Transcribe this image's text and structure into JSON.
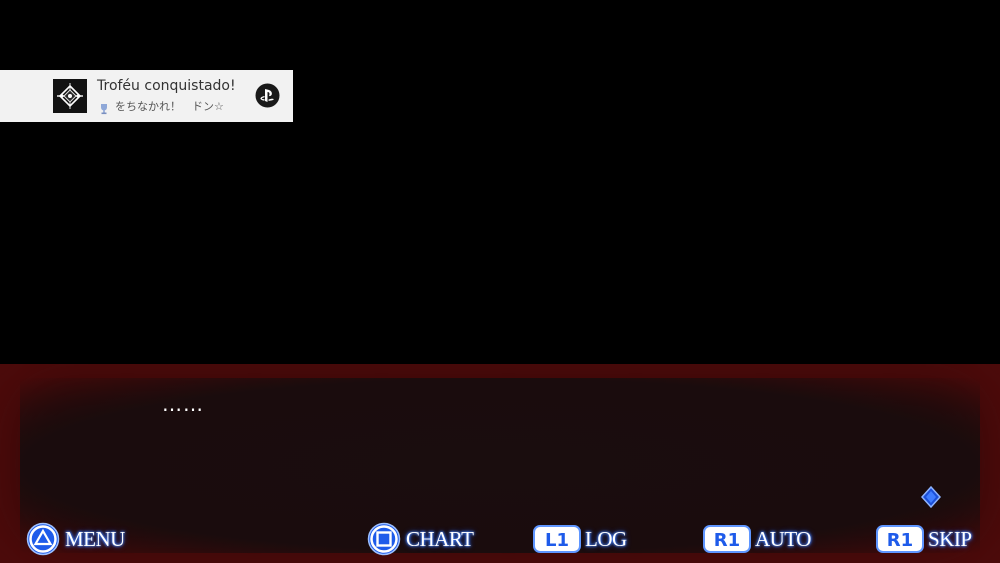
{
  "trophy_notification": {
    "title": "Troféu conquistado!",
    "trophy_name": "をちなかれ！　ドン☆",
    "tier_icon": "silver-trophy-icon",
    "platform_icon": "playstation-logo-icon"
  },
  "dialogue": {
    "text": "……"
  },
  "controls": [
    {
      "button": "triangle",
      "label": "MENU"
    },
    {
      "button": "square",
      "label": "CHART"
    },
    {
      "button": "L1",
      "label": "LOG"
    },
    {
      "button": "R1",
      "label": "AUTO"
    },
    {
      "button": "R1",
      "label": "SKIP"
    }
  ],
  "colors": {
    "glow": "#2f6bff",
    "dialogue_border": "#4e0b0b"
  }
}
